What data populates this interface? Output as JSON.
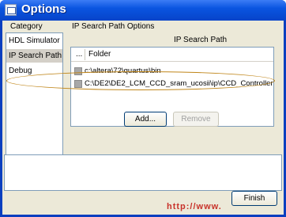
{
  "window": {
    "title": "Options"
  },
  "category": {
    "label": "Category",
    "items": [
      {
        "label": "HDL Simulator",
        "selected": false
      },
      {
        "label": "IP Search Path",
        "selected": true
      },
      {
        "label": "Debug",
        "selected": false
      }
    ]
  },
  "ip_search": {
    "group_label": "IP Search Path Options",
    "table_title": "IP Search Path",
    "columns": {
      "marker": "...",
      "folder": "Folder"
    },
    "rows": [
      {
        "path": "c:\\altera\\72\\quartus\\bin"
      },
      {
        "path": "C:\\DE2\\DE2_LCM_CCD_sram_ucosii\\ip\\CCD_Controller"
      }
    ],
    "add_label": "Add...",
    "remove_label": "Remove"
  },
  "footer": {
    "finish_label": "Finish",
    "watermark": "http://www."
  },
  "colors": {
    "titlebar": "#0a54e0",
    "dialog_bg": "#ece9d8",
    "highlight_ellipse": "#c0861a"
  }
}
